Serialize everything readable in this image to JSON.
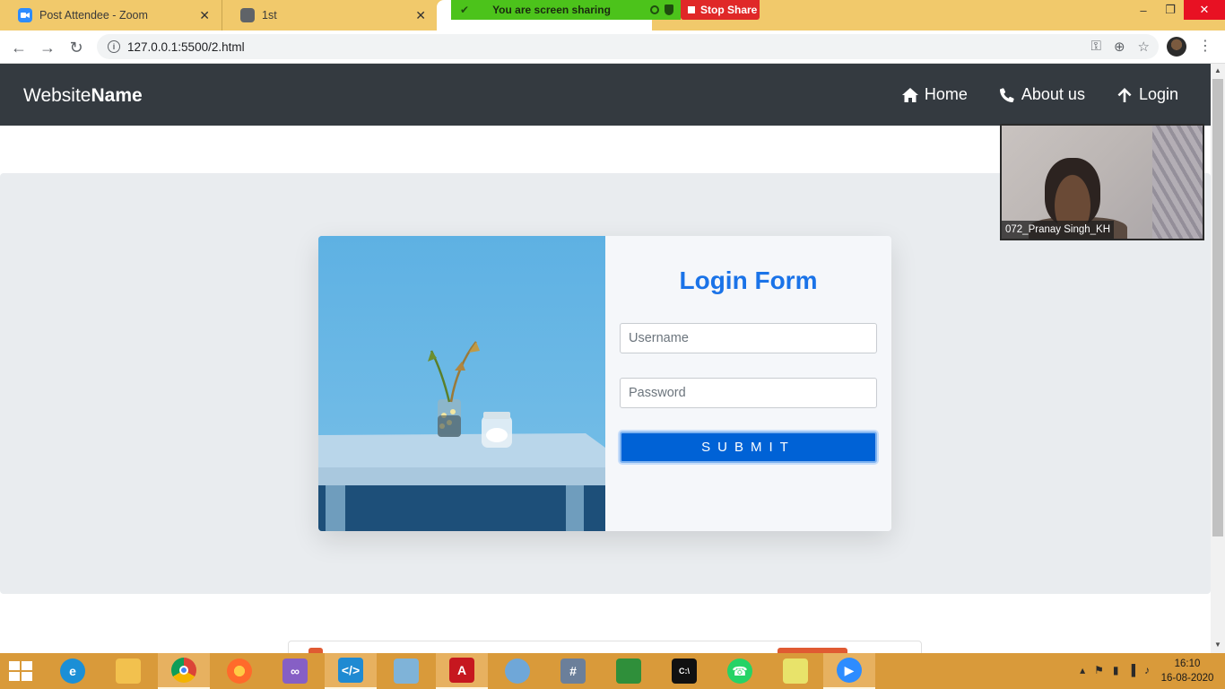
{
  "browser": {
    "tabs": [
      {
        "title": "Post Attendee - Zoom",
        "close": "✕"
      },
      {
        "title": "1st",
        "close": "✕"
      }
    ],
    "address": "127.0.0.1:5500/2.html"
  },
  "zoom_share": {
    "banner_text": "You are screen sharing",
    "stop_label": "Stop Share"
  },
  "navbar": {
    "brand_prefix": "Website",
    "brand_bold": "Name",
    "links": [
      {
        "label": "Home",
        "icon": "home-icon"
      },
      {
        "label": "About us",
        "icon": "phone-icon"
      },
      {
        "label": "Login",
        "icon": "arrow-up-icon"
      }
    ]
  },
  "login": {
    "title": "Login Form",
    "username_placeholder": "Username",
    "password_placeholder": "Password",
    "submit_label": "SUBMIT"
  },
  "video": {
    "participant_name": "072_Pranay Singh_KH"
  },
  "taskbar": {
    "time": "16:10",
    "date": "16-08-2020"
  },
  "colors": {
    "navbar_bg": "#343a40",
    "accent_blue": "#1a73e8",
    "submit_bg": "#0062d6",
    "hero_bg": "#e9ecef",
    "tab_strip": "#f1c96b",
    "taskbar": "#d99a3a"
  }
}
